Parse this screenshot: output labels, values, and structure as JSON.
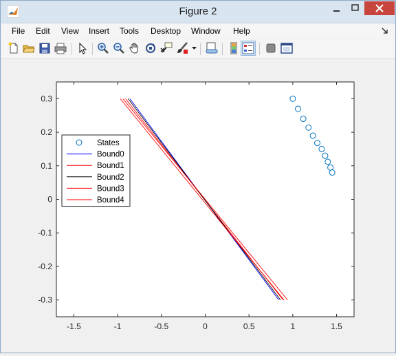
{
  "window": {
    "title": "Figure 2"
  },
  "menu": [
    "File",
    "Edit",
    "View",
    "Insert",
    "Tools",
    "Desktop",
    "Window",
    "Help"
  ],
  "toolbar_icons": [
    "new-figure-icon",
    "open-file-icon",
    "save-icon",
    "print-icon",
    "edit-plot-arrow-icon",
    "zoom-in-icon",
    "zoom-out-icon",
    "pan-hand-icon",
    "rotate-3d-icon",
    "data-cursor-icon",
    "brush-icon",
    "brush-dropdown-icon",
    "link-plot-icon",
    "insert-colorbar-icon",
    "insert-legend-icon",
    "hide-plot-tools-icon",
    "show-plot-tools-icon"
  ],
  "colors": {
    "blue": "#0000ff",
    "red": "#ff0000",
    "black": "#000000",
    "marker": "#0072bd"
  },
  "chart_data": {
    "type": "line",
    "xlim": [
      -1.7,
      1.7
    ],
    "ylim": [
      -0.35,
      0.35
    ],
    "xticks": [
      -1.5,
      -1,
      -0.5,
      0,
      0.5,
      1,
      1.5
    ],
    "xtick_labels": [
      "-1.5",
      "-1",
      "-0.5",
      "0",
      "0.5",
      "1",
      "1.5"
    ],
    "yticks": [
      -0.3,
      -0.2,
      -0.1,
      0,
      0.1,
      0.2,
      0.3
    ],
    "ytick_labels": [
      "-0.3",
      "-0.2",
      "-0.1",
      "0",
      "0.1",
      "0.2",
      "0.3"
    ],
    "grid": false,
    "legend_position": "left",
    "series": [
      {
        "name": "States",
        "style": "marker",
        "color": "#0072bd",
        "x": [
          1.0,
          1.06,
          1.12,
          1.18,
          1.23,
          1.28,
          1.33,
          1.37,
          1.4,
          1.43,
          1.45
        ],
        "y": [
          0.3,
          0.27,
          0.24,
          0.214,
          0.19,
          0.168,
          0.15,
          0.13,
          0.112,
          0.095,
          0.08
        ]
      },
      {
        "name": "Bound0",
        "style": "line",
        "color": "#0000ff",
        "x": [
          -0.86,
          0.84
        ],
        "y": [
          0.3,
          -0.3
        ]
      },
      {
        "name": "Bound1",
        "style": "line",
        "color": "#ff0000",
        "x": [
          -0.91,
          0.89
        ],
        "y": [
          0.3,
          -0.3
        ]
      },
      {
        "name": "Bound2",
        "style": "line",
        "color": "#000000",
        "x": [
          -0.88,
          0.86
        ],
        "y": [
          0.3,
          -0.3
        ]
      },
      {
        "name": "Bound3",
        "style": "line",
        "color": "#ff0000",
        "x": [
          -0.94,
          0.94
        ],
        "y": [
          0.3,
          -0.3
        ]
      },
      {
        "name": "Bound4",
        "style": "line",
        "color": "#ff0000",
        "x": [
          -0.97,
          0.9
        ],
        "y": [
          0.3,
          -0.3
        ]
      }
    ]
  }
}
